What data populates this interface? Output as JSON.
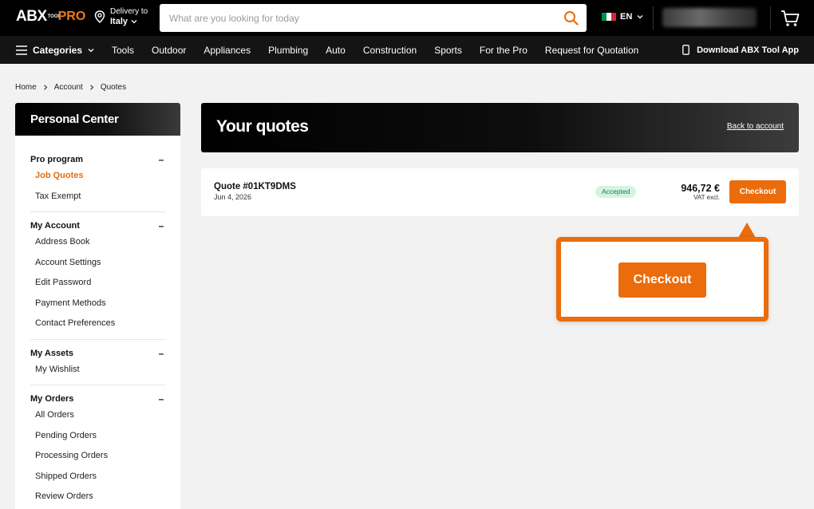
{
  "header": {
    "logo": {
      "brand": "ABX",
      "tool": "TOOL",
      "pro": "PRO"
    },
    "delivery": {
      "label": "Delivery to",
      "value": "Italy"
    },
    "search": {
      "placeholder": "What are you looking for today"
    },
    "language": {
      "code": "EN",
      "flag_colors": [
        "#009246",
        "#ffffff",
        "#ce2b37"
      ]
    }
  },
  "nav": {
    "categories_label": "Categories",
    "items": [
      "Tools",
      "Outdoor",
      "Appliances",
      "Plumbing",
      "Auto",
      "Construction",
      "Sports",
      "For the Pro",
      "Request for Quotation"
    ],
    "app_label": "Download ABX Tool App"
  },
  "breadcrumb": [
    "Home",
    "Account",
    "Quotes"
  ],
  "sidebar": {
    "title": "Personal Center",
    "groups": [
      {
        "title": "Pro program",
        "toggle": "–",
        "items": [
          {
            "label": "Job Quotes",
            "active": true
          },
          {
            "label": "Tax Exempt"
          }
        ]
      },
      {
        "title": "My Account",
        "toggle": "–",
        "items": [
          {
            "label": "Address Book"
          },
          {
            "label": "Account Settings"
          },
          {
            "label": "Edit Password"
          },
          {
            "label": "Payment Methods"
          },
          {
            "label": "Contact Preferences"
          }
        ]
      },
      {
        "title": "My Assets",
        "toggle": "–",
        "items": [
          {
            "label": "My Wishlist"
          }
        ]
      },
      {
        "title": "My Orders",
        "toggle": "–",
        "items": [
          {
            "label": "All Orders"
          },
          {
            "label": "Pending Orders"
          },
          {
            "label": "Processing Orders"
          },
          {
            "label": "Shipped Orders"
          },
          {
            "label": "Review Orders"
          }
        ]
      }
    ]
  },
  "main": {
    "title": "Your quotes",
    "back_label": "Back to account",
    "quotes": [
      {
        "id": "Quote #01KT9DMS",
        "date": "Jun 4, 2026",
        "status": "Accepted",
        "amount": "946,72 €",
        "vat": "VAT excl.",
        "checkout_label": "Checkout"
      }
    ]
  },
  "callout": {
    "label": "Checkout"
  },
  "colors": {
    "accent": "#ea6c0b",
    "status_accepted_bg": "#d4f3e3",
    "status_accepted_text": "#1a7a4a"
  }
}
